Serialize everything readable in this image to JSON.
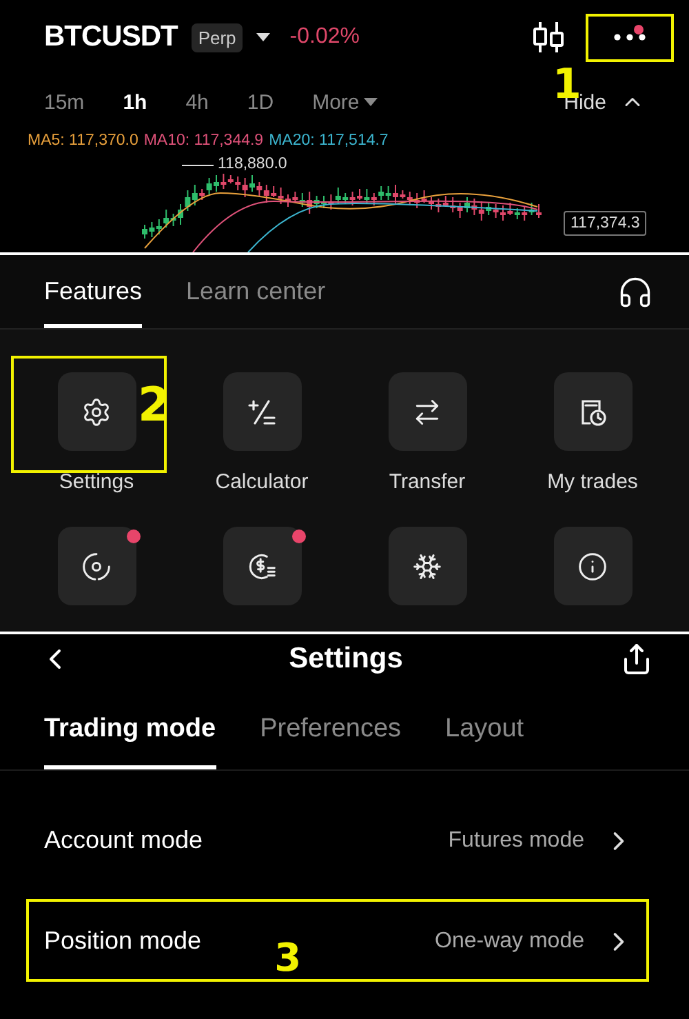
{
  "header": {
    "symbol": "BTCUSDT",
    "badge": "Perp",
    "change": "-0.02%",
    "more_notification": true,
    "more_callout": "1"
  },
  "intervals": [
    {
      "label": "15m",
      "selected": false
    },
    {
      "label": "1h",
      "selected": true
    },
    {
      "label": "4h",
      "selected": false
    },
    {
      "label": "1D",
      "selected": false
    },
    {
      "label": "More",
      "selected": false,
      "kind": "dropdown"
    }
  ],
  "hide_toggle": "Hide",
  "indicators": [
    {
      "label": "MA5: 117,370.0",
      "color": "#e8a03c"
    },
    {
      "label": "MA10: 117,344.9",
      "color": "#e0527a"
    },
    {
      "label": "MA20: 117,514.7",
      "color": "#3cb6d0"
    }
  ],
  "chart": {
    "high_label": "118,880.0",
    "price_label": "117,374.3"
  },
  "features": {
    "tabs": [
      {
        "label": "Features",
        "selected": true
      },
      {
        "label": "Learn center",
        "selected": false
      }
    ],
    "items": [
      {
        "label": "Settings",
        "notification": false,
        "callout": "2"
      },
      {
        "label": "Calculator",
        "notification": false
      },
      {
        "label": "Transfer",
        "notification": false
      },
      {
        "label": "My trades",
        "notification": false
      },
      {
        "notification": true
      },
      {
        "notification": true
      },
      {
        "notification": false
      },
      {
        "notification": false
      }
    ]
  },
  "settings": {
    "title": "Settings",
    "tabs": [
      {
        "label": "Trading mode",
        "selected": true
      },
      {
        "label": "Preferences",
        "selected": false
      },
      {
        "label": "Layout",
        "selected": false
      }
    ],
    "rows": [
      {
        "label": "Account mode",
        "value": "Futures mode"
      },
      {
        "label": "Position mode",
        "value": "One-way mode",
        "callout": "3"
      }
    ]
  }
}
